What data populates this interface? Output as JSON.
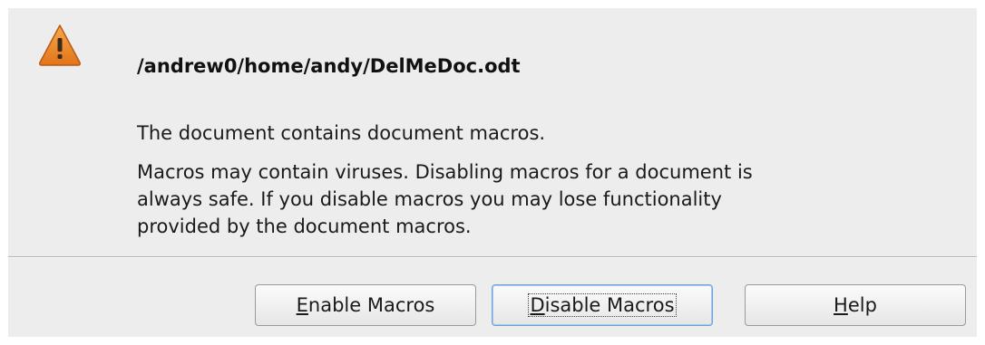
{
  "dialog": {
    "file_path": "/andrew0/home/andy/DelMeDoc.odt",
    "message_primary": "The document contains document macros.",
    "message_secondary_lines": [
      "Macros may contain viruses. Disabling macros for a document is",
      "always safe. If you disable macros you may lose functionality",
      "provided by the document macros."
    ],
    "icon": "warning-triangle-icon",
    "icon_color": "#f08a24"
  },
  "buttons": {
    "enable": {
      "mnemonic": "E",
      "rest": "nable Macros"
    },
    "disable": {
      "mnemonic": "D",
      "rest": "isable Macros"
    },
    "help": {
      "mnemonic": "H",
      "rest": "elp"
    }
  }
}
